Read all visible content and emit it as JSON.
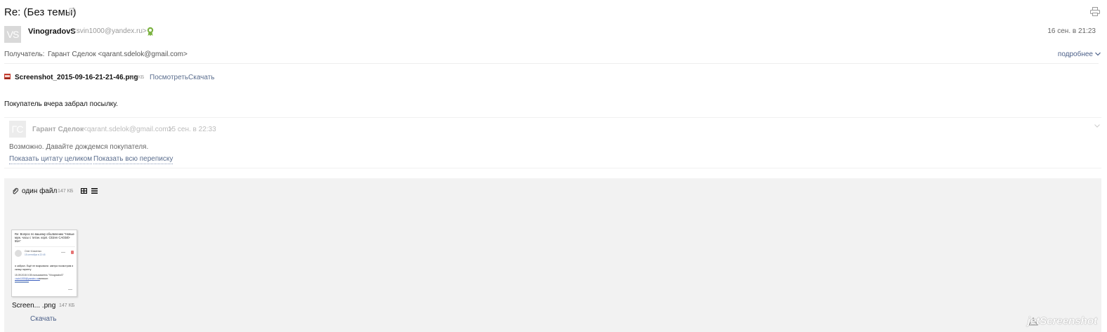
{
  "message": {
    "subject": "Re: (Без темы)",
    "sender": {
      "initials": "VS",
      "name": "VinogradovS",
      "email": "<svin1000@yandex.ru>"
    },
    "date": "16 сен. в 21:23",
    "recipient_label": "Получатель:",
    "recipient": "Гарант Сделок <qarant.sdelok@gmail.com>",
    "details_label": "подробнее",
    "body": "Покупатель вчера забрал посылку."
  },
  "attachment": {
    "filename": "Screenshot_2015-09-16-21-21-46.png",
    "size": "147 КБ",
    "view_label": "Посмотреть",
    "download_label": "Скачать"
  },
  "quote": {
    "initials": "ГС",
    "name": "Гарант Сделок",
    "email": "<qarant.sdelok@gmail.com>",
    "date": "15 сен. в 22:33",
    "text": "Возможно. Давайте дождемся покупателя.",
    "show_full_label": "Показать цитату целиком",
    "show_thread_label": "Показать всю переписку"
  },
  "files_panel": {
    "title": "один файл",
    "size": "147 КБ",
    "thumb_name": "Screen... .png",
    "thumb_size": "147 КБ",
    "download_label": "Скачать"
  },
  "thumbnail_preview": {
    "heading": "Re: Вопрос по вашему объявлению \"Новые муж. часы с титан. корп. Citizen CA0340-55A\"",
    "author": "Олег Клименко",
    "when": "15 сентября в 22:45",
    "body": "я забрал. Ещё не вскрывали. завтра посмотрим и скажу гаранту",
    "quote_intro": "15.09.2015 0:35 пользователь \"VinogradovS\"",
    "quote_email": "<svin1000@yandex.ru>",
    "quote_suffix": "написал:"
  },
  "watermark": "jetScreenshot",
  "colors": {
    "link": "#5b6e8e",
    "verified_badge": "#7cb342",
    "attachment_icon": "#c0392b",
    "panel_bg": "#f2f2f2"
  }
}
